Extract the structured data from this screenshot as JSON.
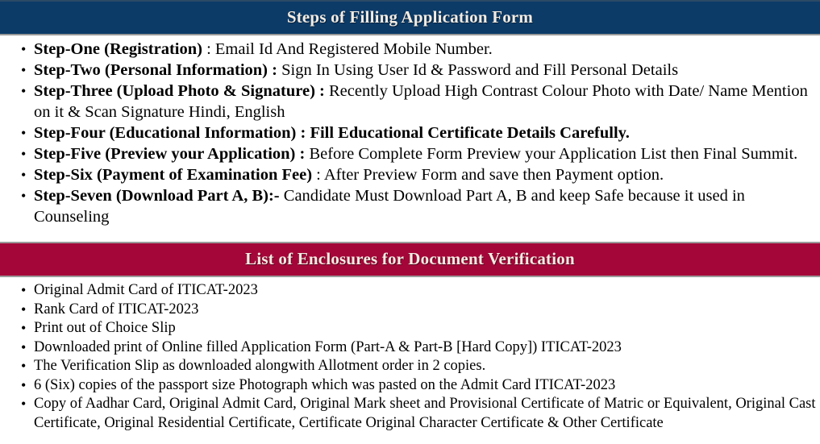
{
  "colors": {
    "header_blue": "#0c3b68",
    "header_maroon": "#a5063a",
    "header_text": "#f3ece2",
    "body_text": "#000000",
    "border_gray": "#9a9a9a"
  },
  "sections": [
    {
      "header": "Steps of Filling Application Form",
      "header_style": "blue",
      "items": [
        {
          "lead": "Step-One (Registration)",
          "tail": " : Email Id And Registered Mobile Number.",
          "tail_bold": false
        },
        {
          "lead": "Step-Two (Personal Information) :",
          "tail": " Sign In Using User Id & Password and Fill Personal Details",
          "tail_bold": false
        },
        {
          "lead": "Step-Three (Upload Photo & Signature) :",
          "tail": " Recently Upload High Contrast Colour Photo with Date/ Name Mention on it & Scan Signature Hindi, English",
          "tail_bold": false
        },
        {
          "lead": "Step-Four (Educational Information) :",
          "tail": "  Fill Educational Certificate Details Carefully.",
          "tail_bold": true
        },
        {
          "lead": "Step-Five (Preview your Application) :",
          "tail": " Before Complete Form Preview your Application List then Final Summit.",
          "tail_bold": false
        },
        {
          "lead": "Step-Six (Payment of Examination Fee)",
          "tail": " : After Preview Form and save then Payment option.",
          "tail_bold": false
        },
        {
          "lead": "Step-Seven (Download Part A, B):-",
          "tail": " Candidate Must Download Part A, B and keep Safe because it used in Counseling",
          "tail_bold": false
        }
      ]
    },
    {
      "header": "List of Enclosures for Document Verification",
      "header_style": "maroon",
      "items": [
        {
          "text": "Original Admit Card of ITICAT-2023"
        },
        {
          "text": "Rank Card of ITICAT-2023"
        },
        {
          "text": "Print out of Choice Slip"
        },
        {
          "text": "Downloaded print of Online filled Application Form (Part-A & Part-B [Hard Copy]) ITICAT-2023"
        },
        {
          "text": "The Verification Slip as downloaded alongwith Allotment order in 2 copies."
        },
        {
          "text": "6 (Six) copies of the passport size Photograph which was pasted on the Admit Card ITICAT-2023"
        },
        {
          "text": "Copy of Aadhar Card, Original Admit Card, Original Mark sheet and Provisional Certificate of Matric or Equivalent, Original Cast Certificate, Original Residential Certificate, Certificate Original Character Certificate & Other Certificate"
        }
      ]
    }
  ]
}
